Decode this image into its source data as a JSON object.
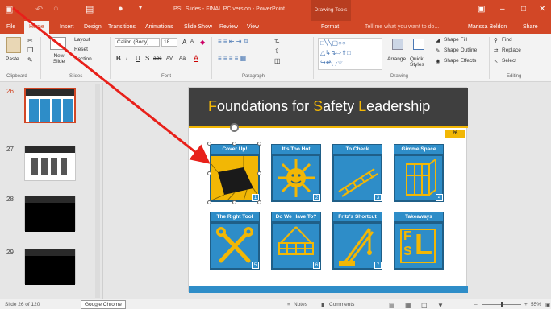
{
  "titlebar": {
    "doc_title": "PSL Slides - FINAL PC version - PowerPoint",
    "context_tab": "Drawing Tools",
    "qat": [
      "save-icon",
      "undo-icon",
      "redo-icon",
      "start-icon",
      "presenter-icon",
      "customize-icon"
    ]
  },
  "tabs": [
    "File",
    "Home",
    "Insert",
    "Design",
    "Transitions",
    "Animations",
    "Slide Show",
    "Review",
    "View",
    "Format"
  ],
  "tell_me": "Tell me what you want to do...",
  "user": "Marissa Beldon",
  "share": "Share",
  "ribbon": {
    "clipboard": {
      "paste": "Paste",
      "label": "Clipboard"
    },
    "slides": {
      "new_slide": "New Slide",
      "layout": "Layout",
      "reset": "Reset",
      "section": "Section",
      "label": "Slides"
    },
    "font": {
      "name": "Calibri (Body)",
      "size": "18",
      "label": "Font",
      "bold": "B",
      "italic": "I",
      "underline": "U",
      "strike": "S",
      "abc": "abc",
      "spacing": "AV",
      "case": "Aa",
      "color": "A",
      "grow": "A",
      "shrink": "A"
    },
    "paragraph": {
      "label": "Paragraph"
    },
    "drawing": {
      "arrange": "Arrange",
      "quick_styles": "Quick Styles",
      "shape_fill": "Shape Fill",
      "shape_outline": "Shape Outline",
      "shape_effects": "Shape Effects",
      "label": "Drawing"
    },
    "editing": {
      "find": "Find",
      "replace": "Replace",
      "select": "Select",
      "label": "Editing"
    }
  },
  "thumbnails": [
    {
      "num": "26",
      "selected": true
    },
    {
      "num": "27",
      "selected": false
    },
    {
      "num": "28",
      "selected": false
    },
    {
      "num": "29",
      "selected": false
    }
  ],
  "slide": {
    "title_parts": [
      {
        "t": "F",
        "accent": true
      },
      {
        "t": "oundations for ",
        "accent": false
      },
      {
        "t": "S",
        "accent": true
      },
      {
        "t": "afety ",
        "accent": false
      },
      {
        "t": "L",
        "accent": true
      },
      {
        "t": "eadership",
        "accent": false
      }
    ],
    "number": "26",
    "cards": [
      {
        "label": "Cover Up!",
        "badge": "1",
        "icon": "floor-hole-icon",
        "selected": true
      },
      {
        "label": "It's Too Hot",
        "badge": "2",
        "icon": "sun-icon",
        "selected": false
      },
      {
        "label": "To Check",
        "badge": "3",
        "icon": "ladder-icon",
        "selected": false
      },
      {
        "label": "Gimme Space",
        "badge": "4",
        "icon": "cage-icon",
        "selected": false
      },
      {
        "label": "The Right Tool",
        "badge": "5",
        "icon": "wrenches-icon",
        "selected": false
      },
      {
        "label": "Do We Have To?",
        "badge": "6",
        "icon": "scaffold-icon",
        "selected": false
      },
      {
        "label": "Fritz's Shortcut",
        "badge": "7",
        "icon": "crane-icon",
        "selected": false
      },
      {
        "label": "Takeaways",
        "badge": "",
        "icon": "fsl-logo-icon",
        "selected": false
      }
    ],
    "logo_letters": [
      "F",
      "S",
      "L"
    ]
  },
  "status": {
    "slide_of": "Slide 26 of 120",
    "tooltip": "Google Chrome",
    "notes": "Notes",
    "comments": "Comments",
    "zoom": "55%"
  },
  "colors": {
    "accent": "#d24726",
    "card_blue": "#2e8dc8",
    "yellow": "#f2b705",
    "arrow": "#e8201a"
  }
}
